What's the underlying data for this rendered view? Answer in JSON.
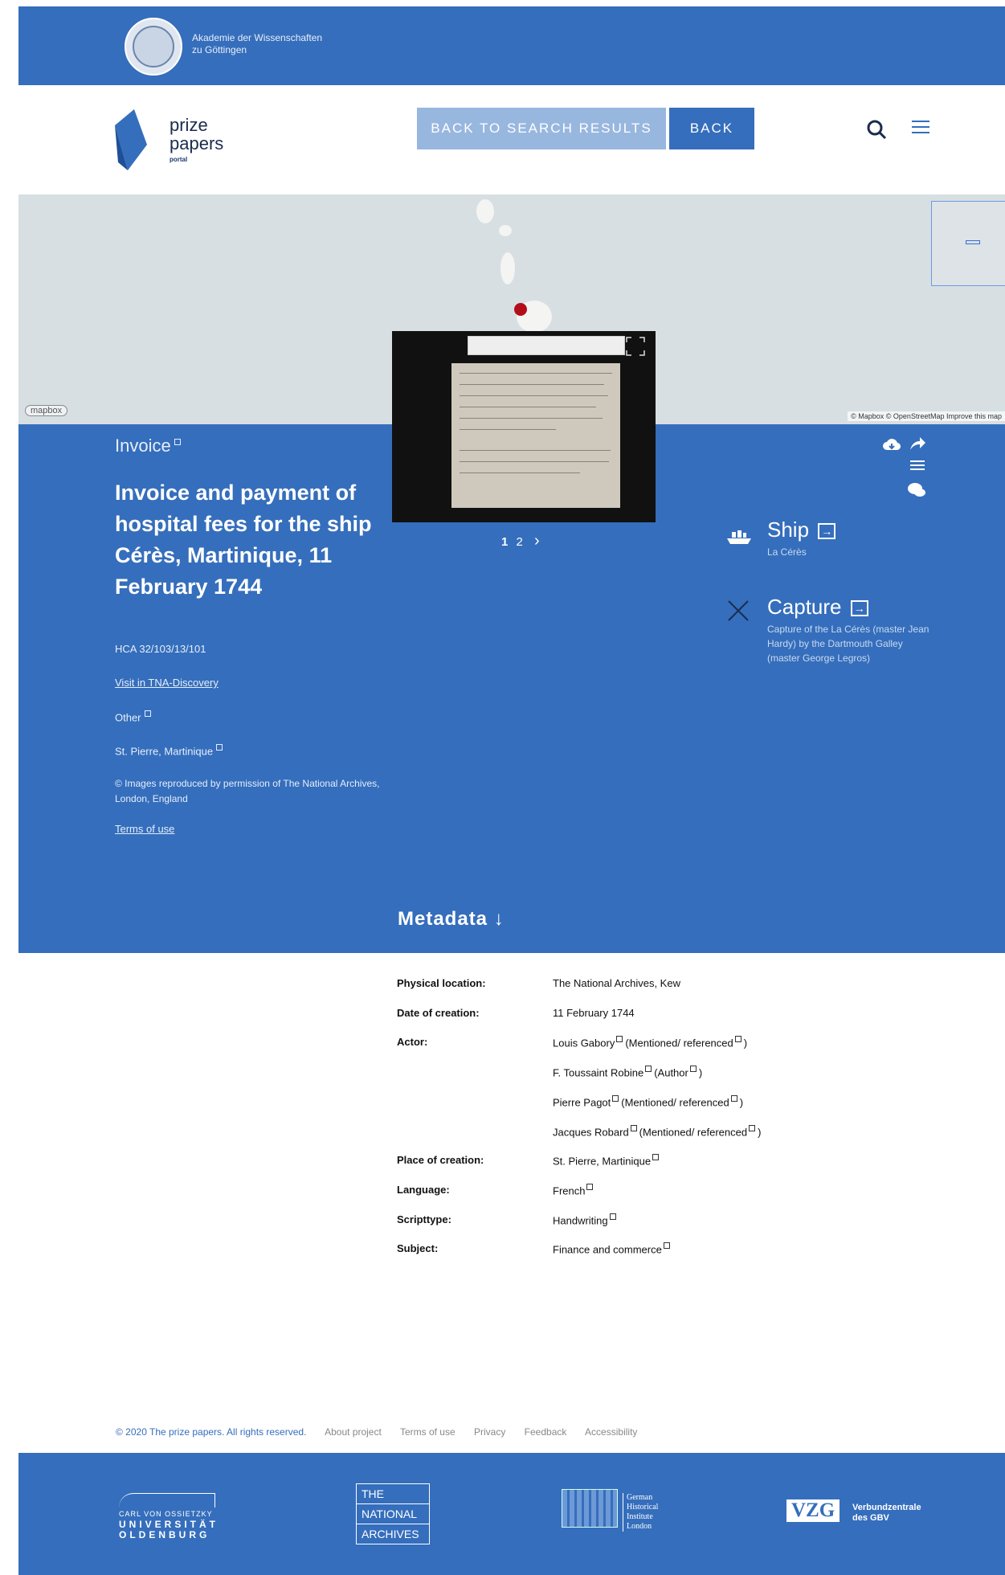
{
  "academy": {
    "name_line1": "Akademie der Wissenschaften",
    "name_line2": "zu Göttingen"
  },
  "logo": {
    "line1": "prize",
    "line2": "papers",
    "line3": "portal"
  },
  "header": {
    "back_results_label": "BACK TO SEARCH RESULTS",
    "back_label": "BACK"
  },
  "map": {
    "mapbox_logo": "mapbox",
    "attribution": "© Mapbox © OpenStreetMap Improve this map"
  },
  "document": {
    "type": "Invoice",
    "title": "Invoice and payment of hospital fees for the ship Cérès, Martinique, 11 February 1744",
    "reference": "HCA 32/103/13/101",
    "discovery_link": "Visit in TNA-Discovery",
    "category": "Other",
    "place": "St. Pierre, Martinique",
    "copyright": "© Images reproduced by permission of The National Archives, London, England",
    "terms_link": "Terms of use"
  },
  "viewer": {
    "page_current": "1",
    "page_other": "2",
    "next": "›"
  },
  "ship": {
    "title": "Ship",
    "name": "La Cérès"
  },
  "capture": {
    "title": "Capture",
    "description": "Capture of the La Cérès (master Jean Hardy) by the Dartmouth Galley (master George Legros)"
  },
  "metadata": {
    "heading": "Metadata ↓",
    "rows": [
      {
        "label": "Physical location:",
        "value": "The National Archives, Kew"
      },
      {
        "label": "Date of creation:",
        "value": "11 February 1744"
      },
      {
        "label": "Actor:",
        "value": "Louis Gabory",
        "role": "(Mentioned/ referenced"
      },
      {
        "label": "",
        "value": "F. Toussaint Robine",
        "role": "(Author"
      },
      {
        "label": "",
        "value": "Pierre Pagot",
        "role": "(Mentioned/ referenced"
      },
      {
        "label": "",
        "value": "Jacques Robard",
        "role": "(Mentioned/ referenced"
      },
      {
        "label": "Place of creation:",
        "value": "St. Pierre, Martinique"
      },
      {
        "label": "Language:",
        "value": "French"
      },
      {
        "label": "Scripttype:",
        "value": "Handwriting"
      },
      {
        "label": "Subject:",
        "value": "Finance and commerce"
      }
    ]
  },
  "footer": {
    "copyright": "© 2020 The prize papers. All rights reserved.",
    "links": [
      "About project",
      "Terms of use",
      "Privacy",
      "Feedback",
      "Accessibility"
    ],
    "uol_line1": "CARL VON OSSIETZKY",
    "uol_line2": "UNIVERSITÄT",
    "uol_line3": "OLDENBURG",
    "tna_line1": "THE",
    "tna_line2": "NATIONAL",
    "tna_line3": "ARCHIVES",
    "ghil_line1": "German",
    "ghil_line2": "Historical",
    "ghil_line3": "Institute",
    "ghil_line4": "London",
    "vzg": "VZG",
    "vzg_text1": "Verbundzentrale",
    "vzg_text2": "des GBV"
  },
  "colors": {
    "brand_blue": "#356ebc",
    "light_blue": "#98b7df",
    "pin_red": "#b40d1a"
  }
}
